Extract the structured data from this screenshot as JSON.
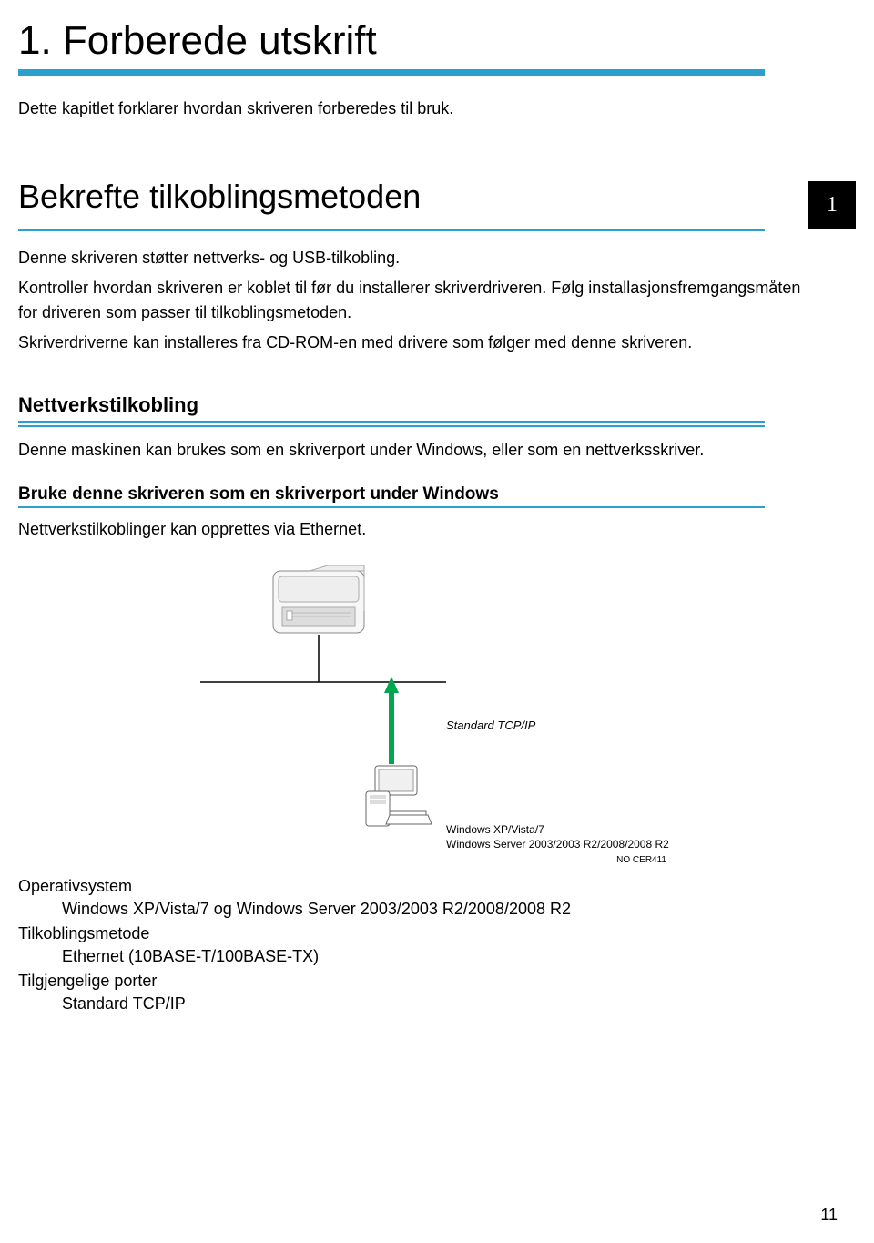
{
  "chapter_badge": "1",
  "page_number": "11",
  "h1": "1. Forberede utskrift",
  "intro": "Dette kapitlet forklarer hvordan skriveren forberedes til bruk.",
  "h2": "Bekrefte tilkoblingsmetoden",
  "p1": "Denne skriveren støtter nettverks- og USB-tilkobling.",
  "p2": "Kontroller hvordan skriveren er koblet til før du installerer skriverdriveren. Følg installasjonsfremgangsmåten for driveren som passer til tilkoblingsmetoden.",
  "p3": "Skriverdriverne kan installeres fra CD-ROM-en med drivere som følger med denne skriveren.",
  "h3": "Nettverkstilkobling",
  "p4": "Denne maskinen kan brukes som en skriverport under Windows, eller som en nettverksskriver.",
  "h4": "Bruke denne skriveren som en skriverport under Windows",
  "p5": "Nettverkstilkoblinger kan opprettes via Ethernet.",
  "diagram": {
    "tcpip": "Standard TCP/IP",
    "os_line1": "Windows XP/Vista/7",
    "os_line2": "Windows Server 2003/2003 R2/2008/2008 R2",
    "code": "NO CER411"
  },
  "defs": {
    "os_term": "Operativsystem",
    "os_val": "Windows XP/Vista/7 og Windows Server 2003/2003 R2/2008/2008 R2",
    "method_term": "Tilkoblingsmetode",
    "method_val": "Ethernet (10BASE-T/100BASE-TX)",
    "ports_term": "Tilgjengelige porter",
    "ports_val": "Standard TCP/IP"
  }
}
